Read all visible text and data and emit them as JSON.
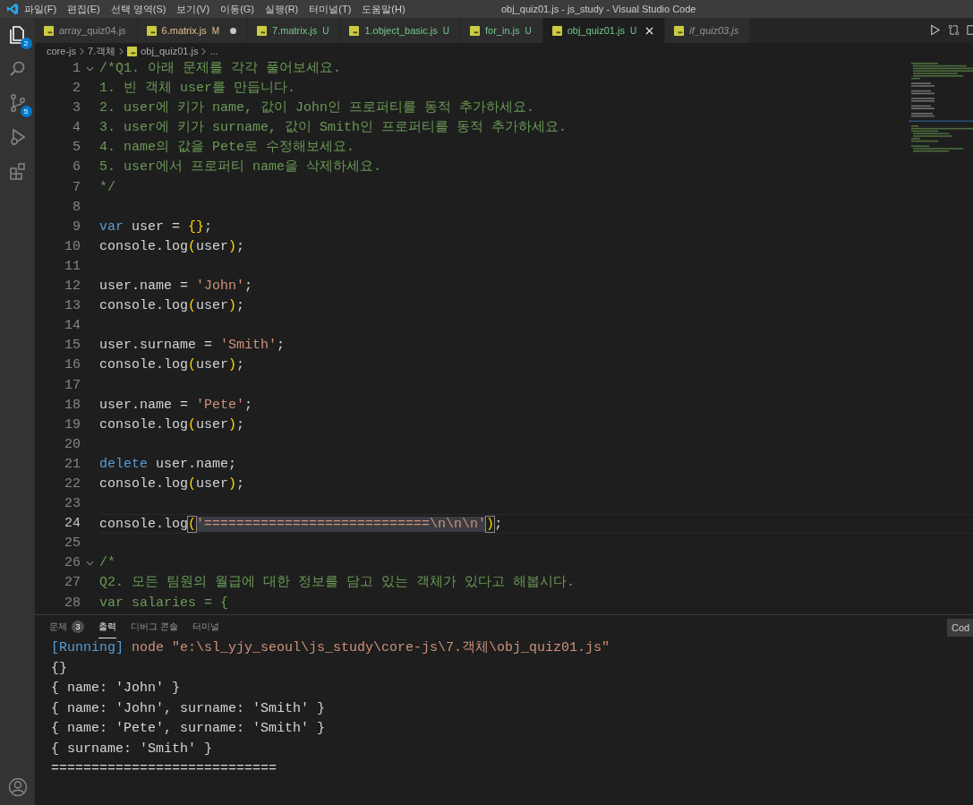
{
  "window": {
    "title": "obj_quiz01.js - js_study - Visual Studio Code"
  },
  "menu": [
    "파일(F)",
    "편집(E)",
    "선택 영역(S)",
    "보기(V)",
    "이동(G)",
    "실행(R)",
    "터미널(T)",
    "도움말(H)"
  ],
  "activity_bar": [
    {
      "kind": "explorer",
      "selected": true,
      "badge": "2"
    },
    {
      "kind": "search",
      "selected": false
    },
    {
      "kind": "source_control",
      "selected": false,
      "badge": "5"
    },
    {
      "kind": "run_debug",
      "selected": false
    },
    {
      "kind": "extensions",
      "selected": false
    }
  ],
  "tabs": [
    {
      "label": "array_quiz04.js",
      "dirty": false,
      "selected": false,
      "preview": false
    },
    {
      "label": "6.matrix.js",
      "status": "M",
      "dirty": true,
      "selected": false,
      "preview": false
    },
    {
      "label": "7.matrix.js",
      "status": "U",
      "dirty": false,
      "selected": false,
      "preview": false
    },
    {
      "label": "1.object_basic.js",
      "status": "U",
      "dirty": false,
      "selected": false,
      "preview": false
    },
    {
      "label": "for_in.js",
      "status": "U",
      "dirty": false,
      "selected": false,
      "preview": false
    },
    {
      "label": "obj_quiz01.js",
      "status": "U",
      "dirty": false,
      "selected": true,
      "preview": false
    },
    {
      "label": "if_quiz03.js",
      "dirty": false,
      "selected": false,
      "preview": true
    }
  ],
  "breadcrumb": [
    {
      "label": "core-js",
      "kind": "folder"
    },
    {
      "label": "7.객체",
      "kind": "folder"
    },
    {
      "label": "obj_quiz01.js",
      "kind": "file"
    },
    {
      "label": "...",
      "kind": "more"
    }
  ],
  "code_lines": [
    {
      "n": "1",
      "fold": true,
      "current": false,
      "tokens": [
        {
          "kind": "comment",
          "text": "/*Q1. 아래 문제를 각각 풀어보세요."
        }
      ]
    },
    {
      "n": "2",
      "fold": false,
      "current": false,
      "tokens": [
        {
          "kind": "comment",
          "text": "1. 빈 객체 user를 만듭니다."
        }
      ]
    },
    {
      "n": "3",
      "fold": false,
      "current": false,
      "tokens": [
        {
          "kind": "comment",
          "text": "2. user에 키가 name, 값이 John인 프로퍼티를 동적 추가하세요."
        }
      ]
    },
    {
      "n": "4",
      "fold": false,
      "current": false,
      "tokens": [
        {
          "kind": "comment",
          "text": "3. user에 키가 surname, 값이 Smith인 프로퍼티를 동적 추가하세요."
        }
      ]
    },
    {
      "n": "5",
      "fold": false,
      "current": false,
      "tokens": [
        {
          "kind": "comment",
          "text": "4. name의 값을 Pete로 수정해보세요."
        }
      ]
    },
    {
      "n": "6",
      "fold": false,
      "current": false,
      "tokens": [
        {
          "kind": "comment",
          "text": "5. user에서 프로퍼티 name을 삭제하세요."
        }
      ]
    },
    {
      "n": "7",
      "fold": false,
      "current": false,
      "tokens": [
        {
          "kind": "comment",
          "text": "*/"
        }
      ]
    },
    {
      "n": "8",
      "fold": false,
      "current": false
    },
    {
      "n": "9",
      "fold": false,
      "current": false,
      "tokens": [
        {
          "kind": "keyword",
          "text": "var"
        },
        {
          "kind": "plain",
          "text": " user = "
        },
        {
          "kind": "bracket",
          "text": "{}"
        },
        {
          "kind": "plain",
          "text": ";"
        }
      ]
    },
    {
      "n": "10",
      "fold": false,
      "current": false,
      "tokens": [
        {
          "kind": "plain",
          "text": "console.log"
        },
        {
          "kind": "bracket",
          "text": "("
        },
        {
          "kind": "plain",
          "text": "user"
        },
        {
          "kind": "bracket",
          "text": ")"
        },
        {
          "kind": "plain",
          "text": ";"
        }
      ]
    },
    {
      "n": "11",
      "fold": false,
      "current": false
    },
    {
      "n": "12",
      "fold": false,
      "current": false,
      "tokens": [
        {
          "kind": "plain",
          "text": "user.name = "
        },
        {
          "kind": "string",
          "text": "'John'"
        },
        {
          "kind": "plain",
          "text": ";"
        }
      ]
    },
    {
      "n": "13",
      "fold": false,
      "current": false,
      "tokens": [
        {
          "kind": "plain",
          "text": "console.log"
        },
        {
          "kind": "bracket",
          "text": "("
        },
        {
          "kind": "plain",
          "text": "user"
        },
        {
          "kind": "bracket",
          "text": ")"
        },
        {
          "kind": "plain",
          "text": ";"
        }
      ]
    },
    {
      "n": "14",
      "fold": false,
      "current": false
    },
    {
      "n": "15",
      "fold": false,
      "current": false,
      "tokens": [
        {
          "kind": "plain",
          "text": "user.surname = "
        },
        {
          "kind": "string",
          "text": "'Smith'"
        },
        {
          "kind": "plain",
          "text": ";"
        }
      ]
    },
    {
      "n": "16",
      "fold": false,
      "current": false,
      "tokens": [
        {
          "kind": "plain",
          "text": "console.log"
        },
        {
          "kind": "bracket",
          "text": "("
        },
        {
          "kind": "plain",
          "text": "user"
        },
        {
          "kind": "bracket",
          "text": ")"
        },
        {
          "kind": "plain",
          "text": ";"
        }
      ]
    },
    {
      "n": "17",
      "fold": false,
      "current": false
    },
    {
      "n": "18",
      "fold": false,
      "current": false,
      "tokens": [
        {
          "kind": "plain",
          "text": "user.name = "
        },
        {
          "kind": "string",
          "text": "'Pete'"
        },
        {
          "kind": "plain",
          "text": ";"
        }
      ]
    },
    {
      "n": "19",
      "fold": false,
      "current": false,
      "tokens": [
        {
          "kind": "plain",
          "text": "console.log"
        },
        {
          "kind": "bracket",
          "text": "("
        },
        {
          "kind": "plain",
          "text": "user"
        },
        {
          "kind": "bracket",
          "text": ")"
        },
        {
          "kind": "plain",
          "text": ";"
        }
      ]
    },
    {
      "n": "20",
      "fold": false,
      "current": false
    },
    {
      "n": "21",
      "fold": false,
      "current": false,
      "tokens": [
        {
          "kind": "keyword",
          "text": "delete"
        },
        {
          "kind": "plain",
          "text": " user.name;"
        }
      ]
    },
    {
      "n": "22",
      "fold": false,
      "current": false,
      "tokens": [
        {
          "kind": "plain",
          "text": "console.log"
        },
        {
          "kind": "bracket",
          "text": "("
        },
        {
          "kind": "plain",
          "text": "user"
        },
        {
          "kind": "bracket",
          "text": ")"
        },
        {
          "kind": "plain",
          "text": ";"
        }
      ]
    },
    {
      "n": "23",
      "fold": false,
      "current": false
    },
    {
      "n": "24",
      "fold": false,
      "current": true,
      "tokens": [
        {
          "kind": "plain",
          "text": "console.log"
        },
        {
          "kind": "matched_bracket",
          "text": "("
        },
        {
          "kind": "selected_string",
          "text": "'============================\\n\\n\\n'"
        },
        {
          "kind": "matched_bracket",
          "text": ")"
        },
        {
          "kind": "plain",
          "text": ";"
        }
      ]
    },
    {
      "n": "25",
      "fold": false,
      "current": false
    },
    {
      "n": "26",
      "fold": true,
      "current": false,
      "tokens": [
        {
          "kind": "comment",
          "text": "/*"
        }
      ]
    },
    {
      "n": "27",
      "fold": false,
      "current": false,
      "tokens": [
        {
          "kind": "comment",
          "text": "Q2. 모든 팀원의 월급에 대한 정보를 담고 있는 객체가 있다고 해봅시다."
        }
      ]
    },
    {
      "n": "28",
      "fold": false,
      "current": false,
      "tokens": [
        {
          "kind": "comment",
          "text": "var salaries = {"
        }
      ]
    }
  ],
  "panel": {
    "tabs": [
      {
        "label": "문제",
        "selected": false,
        "badge": "3"
      },
      {
        "label": "출력",
        "selected": true
      },
      {
        "label": "디버그 콘솔",
        "selected": false
      },
      {
        "label": "터미널",
        "selected": false
      }
    ],
    "dropdown": "Cod",
    "output": [
      [
        {
          "kind": "tag",
          "text": "[Running]"
        },
        {
          "kind": "command",
          "text": " node \"e:\\sl_yjy_seoul\\js_study\\core-js\\7.객체\\obj_quiz01.js\""
        }
      ],
      [
        {
          "kind": "plain",
          "text": "{}"
        }
      ],
      [
        {
          "kind": "plain",
          "text": "{ name: 'John' }"
        }
      ],
      [
        {
          "kind": "plain",
          "text": "{ name: 'John', surname: 'Smith' }"
        }
      ],
      [
        {
          "kind": "plain",
          "text": "{ name: 'Pete', surname: 'Smith' }"
        }
      ],
      [
        {
          "kind": "plain",
          "text": "{ surname: 'Smith' }"
        }
      ],
      [
        {
          "kind": "plain",
          "text": "============================"
        }
      ]
    ]
  }
}
